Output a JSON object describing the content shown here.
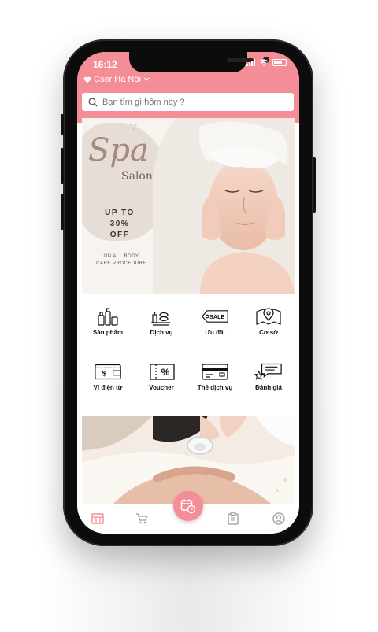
{
  "status_bar": {
    "time": "16:12"
  },
  "header": {
    "location": "Cser Hà Nội"
  },
  "search": {
    "placeholder": "Bạn tìm gì hôm nay ?"
  },
  "banner": {
    "script_title": "Spa",
    "subtitle": "Salon",
    "offer_line1": "UP TO",
    "offer_line2": "30%",
    "offer_line3": "OFF",
    "sub_line1": "ON ALL BODY",
    "sub_line2": "CARE PROCEDURE"
  },
  "categories": [
    {
      "label": "Sản phẩm",
      "icon": "products-icon"
    },
    {
      "label": "Dịch vụ",
      "icon": "services-icon"
    },
    {
      "label": "Ưu đãi",
      "icon": "sale-tag-icon",
      "icon_text": "SALE"
    },
    {
      "label": "Cơ sở",
      "icon": "map-pin-icon"
    },
    {
      "label": "Ví điện tử",
      "icon": "wallet-icon",
      "icon_text": "$"
    },
    {
      "label": "Voucher",
      "icon": "voucher-icon",
      "icon_text": "%"
    },
    {
      "label": "Thẻ dịch vụ",
      "icon": "card-icon"
    },
    {
      "label": "Đánh giá",
      "icon": "review-icon"
    }
  ],
  "bottom_nav": [
    {
      "name": "home-tab",
      "icon": "home-grid-icon",
      "active": true
    },
    {
      "name": "cart-tab",
      "icon": "cart-icon",
      "active": false
    },
    {
      "name": "booking-button",
      "icon": "calendar-clock-icon",
      "active": false
    },
    {
      "name": "orders-tab",
      "icon": "clipboard-icon",
      "active": false
    },
    {
      "name": "profile-tab",
      "icon": "user-icon",
      "active": false
    }
  ],
  "colors": {
    "accent": "#f48d95",
    "frame": "#0c0c0c",
    "text": "#111111"
  }
}
